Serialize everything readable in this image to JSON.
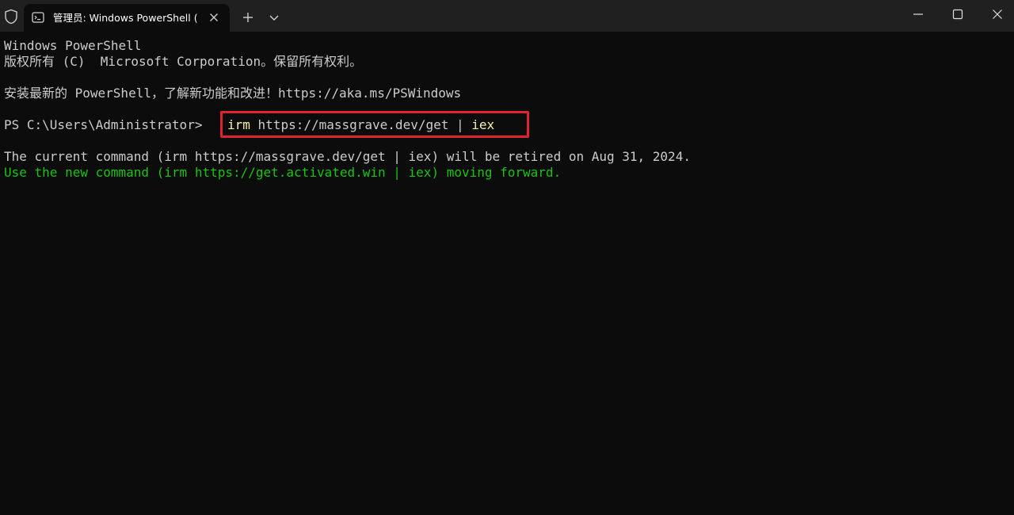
{
  "titlebar": {
    "tab_title": "管理员: Windows PowerShell (",
    "shield_icon": "shield-icon",
    "tab_icon": "terminal-icon",
    "close_tab_icon": "close-icon",
    "new_tab_icon": "plus-icon",
    "dropdown_icon": "chevron-down-icon",
    "window_controls": [
      "minimize-icon",
      "maximize-icon",
      "close-icon"
    ]
  },
  "terminal": {
    "line1": "Windows PowerShell",
    "line2": "版权所有 (C)  Microsoft Corporation。保留所有权利。",
    "line3": "安装最新的 PowerShell，了解新功能和改进！https://aka.ms/PSWindows",
    "prompt": "PS C:\\Users\\Administrator>",
    "command": {
      "keyword": "irm",
      "arg": " https://massgrave.dev/get ",
      "pipe": "|",
      "keyword2": " iex"
    },
    "line5": "The current command (irm https://massgrave.dev/get | iex) will be retired on Aug 31, 2024.",
    "line6": "Use the new command (irm https://get.activated.win | iex) moving forward."
  },
  "colors": {
    "background": "#0c0c0c",
    "titlebar": "#202020",
    "text": "#cccccc",
    "keyword": "#f9f1a5",
    "success": "#16c60c",
    "highlight_box": "#e0242b"
  }
}
